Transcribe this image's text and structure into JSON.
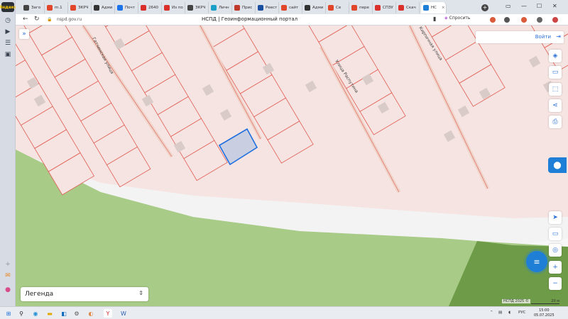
{
  "browser": {
    "tabs": [
      {
        "label": "Заго",
        "color": "#444"
      },
      {
        "label": "m.1",
        "color": "#e2462a"
      },
      {
        "label": "ЗКРЧ",
        "color": "#e2462a"
      },
      {
        "label": "Адми",
        "color": "#333"
      },
      {
        "label": "Почт",
        "color": "#1a73e8"
      },
      {
        "label": "2640",
        "color": "#d9302c"
      },
      {
        "label": "Из по",
        "color": "#d9302c"
      },
      {
        "label": "ЗКРЧ",
        "color": "#444"
      },
      {
        "label": "Личн",
        "color": "#1aa0c8"
      },
      {
        "label": "Прис",
        "color": "#c0392b"
      },
      {
        "label": "Реест",
        "color": "#1a4fa0"
      },
      {
        "label": "сайт",
        "color": "#e2462a"
      },
      {
        "label": "Адми",
        "color": "#333"
      },
      {
        "label": "Се",
        "color": "#e2462a"
      },
      {
        "label": "пере",
        "color": "#e2462a"
      },
      {
        "label": "СПЗУ",
        "color": "#d9302c"
      },
      {
        "label": "Скач",
        "color": "#d9302c"
      }
    ],
    "active_tab": {
      "label": "НС",
      "color": "#1f7fd6"
    },
    "new_tab": "+",
    "url": "nspd.gov.ru",
    "page_title": "НСПД | Геоинформационный портал",
    "ask_label": "Спросить",
    "yandex_label": "Яндекс"
  },
  "map": {
    "login_label": "Войти",
    "streets": [
      {
        "label": "Гатчинская улица"
      },
      {
        "label": "Улица Распутина"
      },
      {
        "label": "Кирпичная улица"
      }
    ],
    "legend_label": "Легенда",
    "copyright": "НСПД 2025 ©",
    "scale": "20 м",
    "zoom_in": "+",
    "zoom_out": "−",
    "colors": {
      "parcel_fill": "#f6e4e2",
      "parcel_line": "#e05a50",
      "selected_fill": "#c9cfe0",
      "selected_line": "#1f6fe0",
      "green": "#a8cb88",
      "dark_green": "#6e9b48",
      "road": "#f3f3f3"
    }
  },
  "taskbar": {
    "lang": "РУС",
    "time": "15:00",
    "date": "05.07.2025"
  }
}
